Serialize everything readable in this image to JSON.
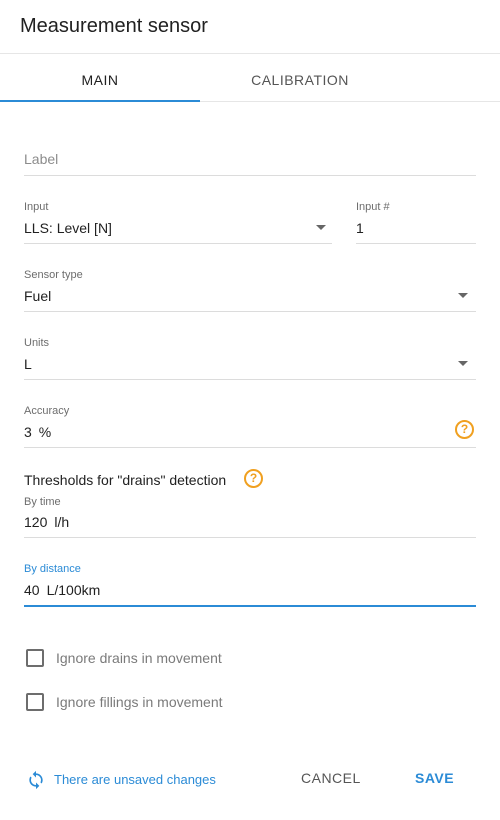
{
  "dialog": {
    "title": "Measurement sensor"
  },
  "tabs": [
    {
      "label": "MAIN",
      "active": true
    },
    {
      "label": "CALIBRATION",
      "active": false
    }
  ],
  "form": {
    "label_field": {
      "placeholder": "Label",
      "value": ""
    },
    "input": {
      "label": "Input",
      "value": "LLS: Level [N]"
    },
    "input_number": {
      "label": "Input #",
      "value": "1"
    },
    "sensor_type": {
      "label": "Sensor type",
      "value": "Fuel"
    },
    "units": {
      "label": "Units",
      "value": "L"
    },
    "accuracy": {
      "label": "Accuracy",
      "value": "3",
      "unit": "%"
    },
    "thresholds": {
      "title": "Thresholds for \"drains\" detection",
      "by_time": {
        "label": "By time",
        "value": "120",
        "unit": "l/h"
      },
      "by_distance": {
        "label": "By distance",
        "value": "40",
        "unit": "L/100km"
      }
    },
    "ignore_drains": {
      "label": "Ignore drains in movement",
      "checked": false
    },
    "ignore_fillings": {
      "label": "Ignore fillings in movement",
      "checked": false
    }
  },
  "footer": {
    "unsaved_text": "There are unsaved changes",
    "cancel_label": "CANCEL",
    "save_label": "SAVE"
  },
  "colors": {
    "accent": "#2b8bd6",
    "help": "#f0a020"
  },
  "icons": {
    "dropdown": "triangle-down-icon",
    "help": "help-circle-icon",
    "sync": "sync-icon"
  }
}
